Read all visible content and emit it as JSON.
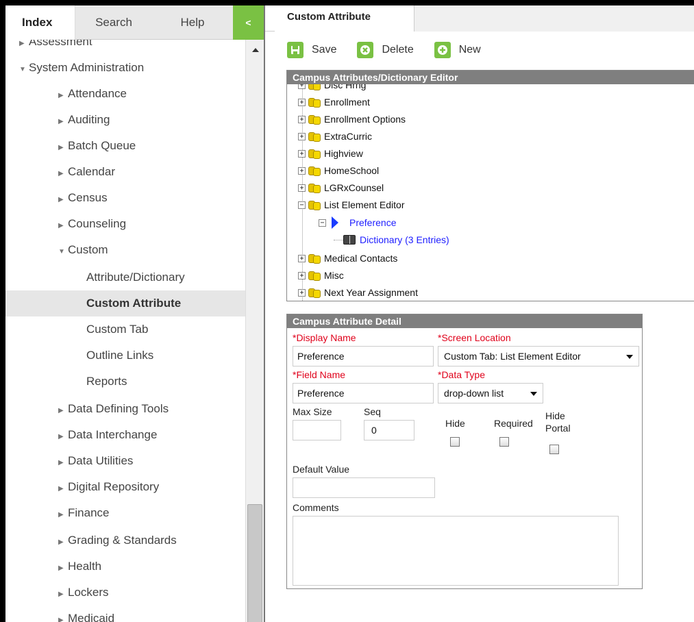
{
  "sidebar": {
    "tabs": {
      "index": "Index",
      "search": "Search",
      "help": "Help",
      "collapse": "<"
    },
    "clipped_item": "Assessment",
    "items": [
      {
        "label": "System Administration",
        "level": 0,
        "tri": "▼"
      },
      {
        "label": "Attendance",
        "level": 1,
        "tri": "▶"
      },
      {
        "label": "Auditing",
        "level": 1,
        "tri": "▶"
      },
      {
        "label": "Batch Queue",
        "level": 1,
        "tri": "▶"
      },
      {
        "label": "Calendar",
        "level": 1,
        "tri": "▶"
      },
      {
        "label": "Census",
        "level": 1,
        "tri": "▶"
      },
      {
        "label": "Counseling",
        "level": 1,
        "tri": "▶"
      },
      {
        "label": "Custom",
        "level": 1,
        "tri": "▼"
      },
      {
        "label": "Attribute/Dictionary",
        "level": 2,
        "tri": ""
      },
      {
        "label": "Custom Attribute",
        "level": 2,
        "tri": "",
        "active": true
      },
      {
        "label": "Custom Tab",
        "level": 2,
        "tri": ""
      },
      {
        "label": "Outline Links",
        "level": 2,
        "tri": ""
      },
      {
        "label": "Reports",
        "level": 2,
        "tri": ""
      },
      {
        "label": "Data Defining Tools",
        "level": 1,
        "tri": "▶"
      },
      {
        "label": "Data Interchange",
        "level": 1,
        "tri": "▶"
      },
      {
        "label": "Data Utilities",
        "level": 1,
        "tri": "▶"
      },
      {
        "label": "Digital Repository",
        "level": 1,
        "tri": "▶"
      },
      {
        "label": "Finance",
        "level": 1,
        "tri": "▶"
      },
      {
        "label": "Grading & Standards",
        "level": 1,
        "tri": "▶"
      },
      {
        "label": "Health",
        "level": 1,
        "tri": "▶"
      },
      {
        "label": "Lockers",
        "level": 1,
        "tri": "▶"
      },
      {
        "label": "Medicaid",
        "level": 1,
        "tri": "▶"
      }
    ]
  },
  "main": {
    "tab_title": "Custom Attribute",
    "toolbar": {
      "save": "Save",
      "delete": "Delete",
      "new": "New"
    },
    "tree_header": "Campus Attributes/Dictionary Editor",
    "tree": [
      {
        "label": "Disc Hrng",
        "kind": "folder",
        "clipped": true
      },
      {
        "label": "Enrollment",
        "kind": "folder"
      },
      {
        "label": "Enrollment Options",
        "kind": "folder"
      },
      {
        "label": "ExtraCurric",
        "kind": "folder"
      },
      {
        "label": "Highview",
        "kind": "folder"
      },
      {
        "label": "HomeSchool",
        "kind": "folder"
      },
      {
        "label": "LGRxCounsel",
        "kind": "folder"
      },
      {
        "label": "List Element Editor",
        "kind": "folder",
        "expanded": true
      },
      {
        "label": "Preference",
        "kind": "attribute"
      },
      {
        "label": "Dictionary (3 Entries)",
        "kind": "dictionary"
      },
      {
        "label": "Medical Contacts",
        "kind": "folder"
      },
      {
        "label": "Misc",
        "kind": "folder"
      },
      {
        "label": "Next Year Assignment",
        "kind": "folder"
      }
    ],
    "detail": {
      "header": "Campus Attribute Detail",
      "display_name_label": "*Display Name",
      "display_name_value": "Preference",
      "screen_location_label": "*Screen Location",
      "screen_location_value": "Custom Tab: List Element Editor",
      "field_name_label": "*Field Name",
      "field_name_value": "Preference",
      "data_type_label": "*Data Type",
      "data_type_value": "drop-down list",
      "max_size_label": "Max Size",
      "max_size_value": "",
      "seq_label": "Seq",
      "seq_value": "0",
      "hide_label": "Hide",
      "required_label": "Required",
      "hide_portal_label_1": "Hide",
      "hide_portal_label_2": "Portal",
      "default_value_label": "Default Value",
      "default_value_value": "",
      "comments_label": "Comments",
      "comments_value": ""
    }
  },
  "colors": {
    "accent_green": "#7ac143",
    "required_red": "#e0001a",
    "panel_header": "#7f7f7f",
    "link_blue": "#2020ff"
  }
}
